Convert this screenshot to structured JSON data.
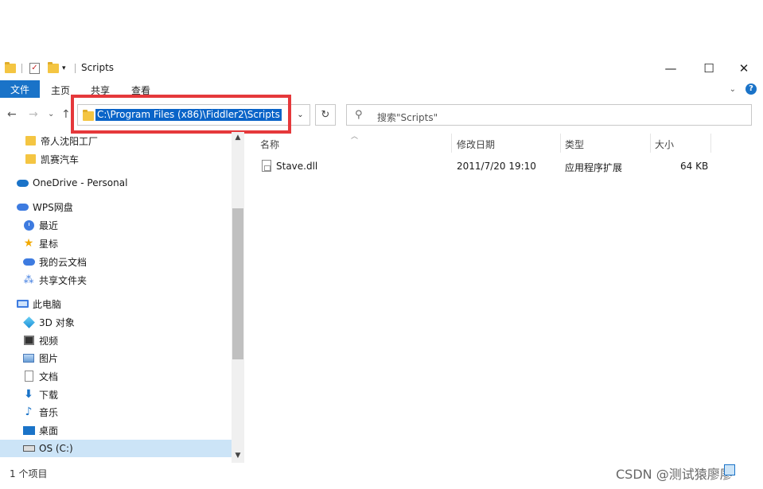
{
  "window": {
    "title": "Scripts",
    "minimize_icon": "minimize-icon",
    "maximize_label": "☐",
    "close_label": "✕"
  },
  "ribbon": {
    "file_tab": "文件",
    "tabs": [
      "主页",
      "共享",
      "查看"
    ]
  },
  "navigation": {
    "address_path": "C:\\Program Files (x86)\\Fiddler2\\Scripts",
    "search_placeholder": "搜索\"Scripts\""
  },
  "sidebar": {
    "items": [
      {
        "label": "帝人沈阳工厂",
        "icon": "folder-icon"
      },
      {
        "label": "凯赛汽车",
        "icon": "folder-icon"
      },
      {
        "label": "OneDrive - Personal",
        "icon": "onedrive-cloud-icon"
      },
      {
        "label": "WPS网盘",
        "icon": "wps-cloud-icon"
      },
      {
        "label": "最近",
        "icon": "recent-clock-icon"
      },
      {
        "label": "星标",
        "icon": "star-icon"
      },
      {
        "label": "我的云文档",
        "icon": "cloud-docs-icon"
      },
      {
        "label": "共享文件夹",
        "icon": "shared-folder-icon"
      },
      {
        "label": "此电脑",
        "icon": "this-pc-icon"
      },
      {
        "label": "3D 对象",
        "icon": "3d-objects-icon"
      },
      {
        "label": "视频",
        "icon": "video-icon"
      },
      {
        "label": "图片",
        "icon": "pictures-icon"
      },
      {
        "label": "文档",
        "icon": "documents-icon"
      },
      {
        "label": "下载",
        "icon": "downloads-icon"
      },
      {
        "label": "音乐",
        "icon": "music-icon"
      },
      {
        "label": "桌面",
        "icon": "desktop-icon"
      },
      {
        "label": "OS (C:)",
        "icon": "drive-icon",
        "selected": true
      }
    ]
  },
  "file_list": {
    "columns": [
      "名称",
      "修改日期",
      "类型",
      "大小"
    ],
    "rows": [
      {
        "name": "Stave.dll",
        "modified": "2011/7/20 19:10",
        "type": "应用程序扩展",
        "size": "64 KB"
      }
    ]
  },
  "status": {
    "item_count": "1 个项目"
  },
  "watermark": "CSDN @测试猿廖廖",
  "colors": {
    "accent": "#1a73c8",
    "selection": "#cce4f7",
    "highlight_box": "#e5383b",
    "folder": "#f4c542"
  }
}
